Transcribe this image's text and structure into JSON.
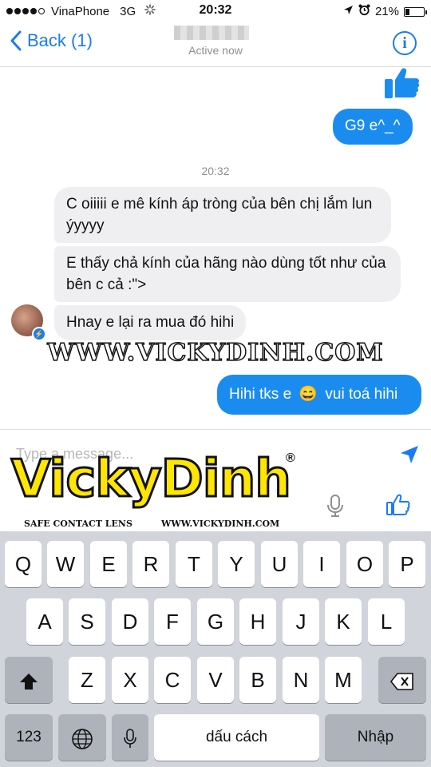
{
  "status_bar": {
    "carrier": "VinaPhone",
    "network": "3G",
    "time": "20:32",
    "battery": "21%",
    "battery_level": 0.21,
    "icons": [
      "signal-dots-icon",
      "activity-spinner-icon",
      "location-arrow-icon",
      "alarm-clock-icon",
      "battery-icon"
    ]
  },
  "nav": {
    "back_label": "Back (1)",
    "active_status": "Active now",
    "info_icon": "info-icon"
  },
  "messages": {
    "sent_1": "G9 e^_^",
    "timestamp": "20:32",
    "received_1": "C oiiiii e mê kính áp tròng của bên chị lắm lun ýyyyy",
    "received_2": "E thấy chả kính của hãng nào dùng tốt như của bên c cả :\">",
    "received_3": "Hnay e lại ra mua đó hihi",
    "sent_2_before": "Hihi tks e",
    "sent_2_emoji": "😄",
    "sent_2_after": "vui toá hihi"
  },
  "watermark": "WWW.VICKYDINH.COM",
  "composer": {
    "placeholder": "Type a message..."
  },
  "logo": {
    "word": "VickyDinh",
    "registered": "®",
    "caption_left": "SAFE CONTACT LENS",
    "caption_right": "WWW.VICKYDINH.COM"
  },
  "keyboard": {
    "row1": [
      "Q",
      "W",
      "E",
      "R",
      "T",
      "Y",
      "U",
      "I",
      "O",
      "P"
    ],
    "row2": [
      "A",
      "S",
      "D",
      "F",
      "G",
      "H",
      "J",
      "K",
      "L"
    ],
    "row3": [
      "Z",
      "X",
      "C",
      "V",
      "B",
      "N",
      "M"
    ],
    "numbers_key": "123",
    "space_key": "dấu cách",
    "return_key": "Nhập"
  },
  "colors": {
    "accent": "#1a7cf5",
    "bubble_sent": "#1a8cf0",
    "bubble_received": "#efeff1",
    "keyboard_bg": "#d1d4da",
    "logo_yellow": "#ffe600"
  }
}
